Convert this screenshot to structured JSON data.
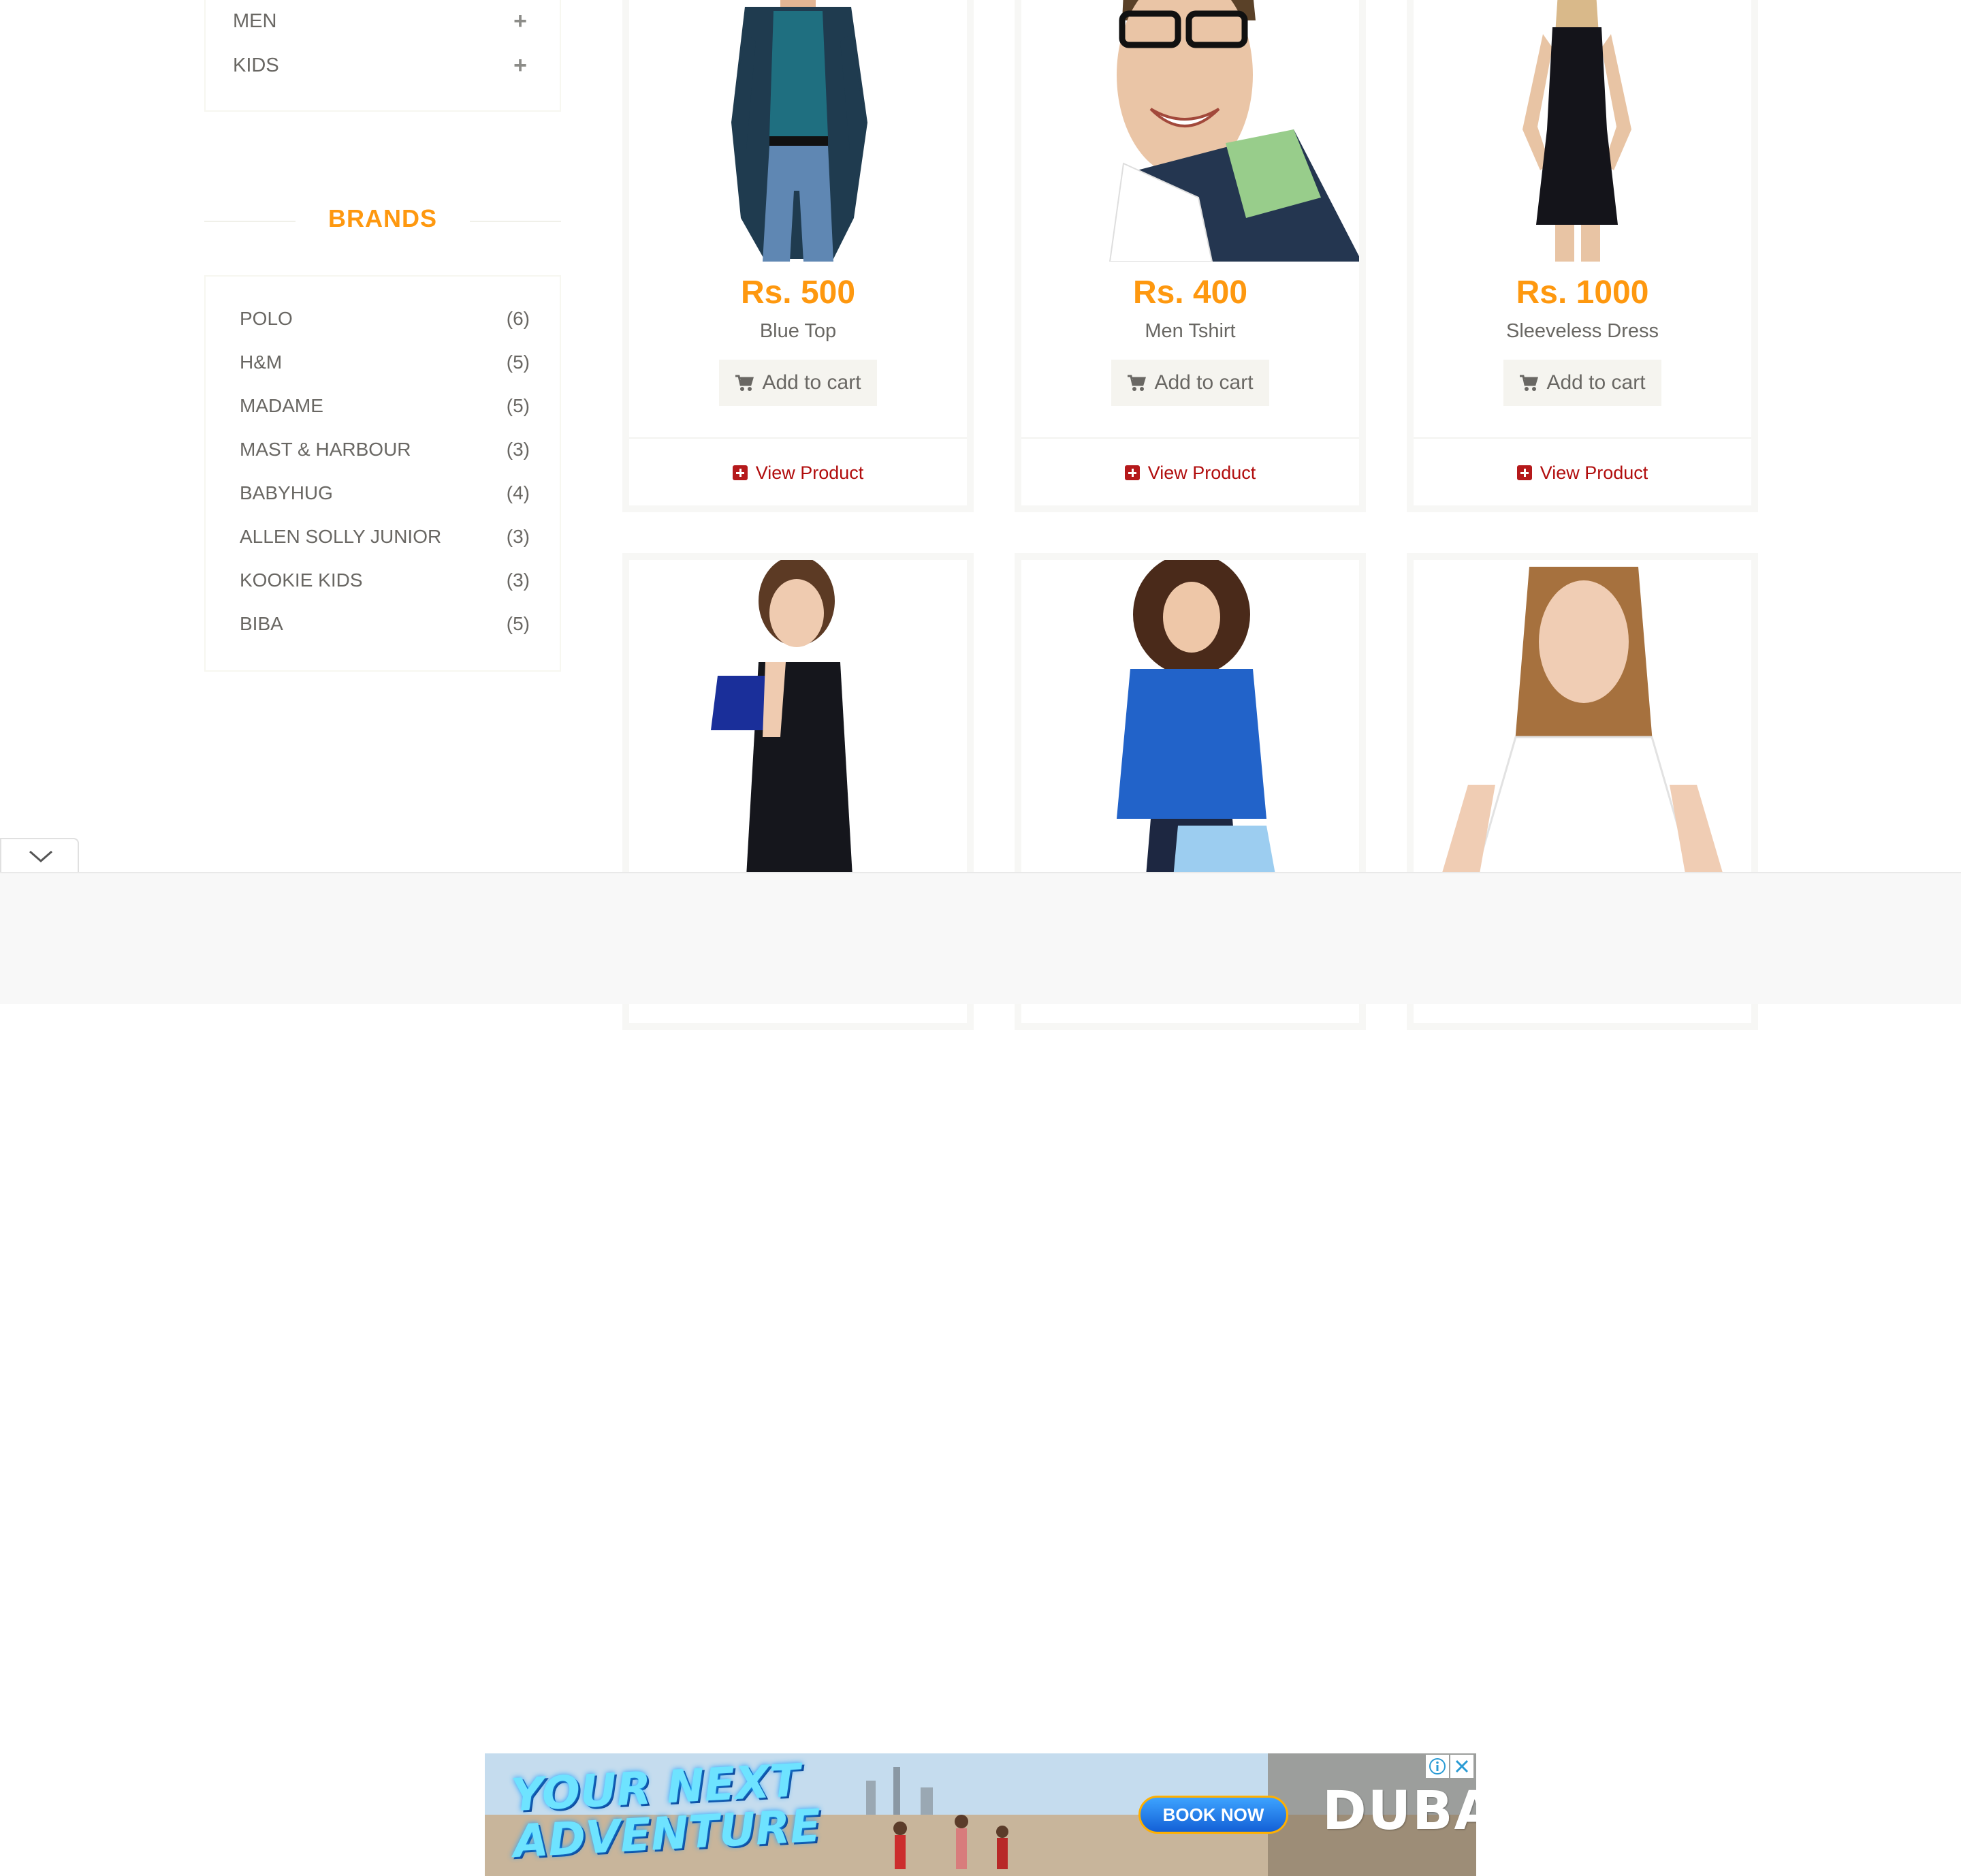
{
  "sidebar": {
    "categories": [
      {
        "label": "MEN",
        "toggle": "+"
      },
      {
        "label": "KIDS",
        "toggle": "+"
      }
    ],
    "brands_title": "BRANDS",
    "brands": [
      {
        "name": "POLO",
        "count": "(6)"
      },
      {
        "name": "H&M",
        "count": "(5)"
      },
      {
        "name": "MADAME",
        "count": "(5)"
      },
      {
        "name": "MAST & HARBOUR",
        "count": "(3)"
      },
      {
        "name": "BABYHUG",
        "count": "(4)"
      },
      {
        "name": "ALLEN SOLLY JUNIOR",
        "count": "(3)"
      },
      {
        "name": "KOOKIE KIDS",
        "count": "(3)"
      },
      {
        "name": "BIBA",
        "count": "(5)"
      }
    ]
  },
  "products": [
    {
      "price": "Rs. 500",
      "name": "Blue Top",
      "add_label": "Add to cart",
      "view_label": "View Product"
    },
    {
      "price": "Rs. 400",
      "name": "Men Tshirt",
      "add_label": "Add to cart",
      "view_label": "View Product"
    },
    {
      "price": "Rs. 1000",
      "name": "Sleeveless Dress",
      "add_label": "Add to cart",
      "view_label": "View Product"
    }
  ],
  "ad": {
    "headline_line1": "YOUR NEXT",
    "headline_line2": "ADVENTURE",
    "cta": "BOOK NOW",
    "brand": "DUBAI",
    "info_icon": "info-icon",
    "close_icon": "close-icon"
  },
  "colors": {
    "accent": "#FE980F",
    "link": "#B10D0D"
  }
}
